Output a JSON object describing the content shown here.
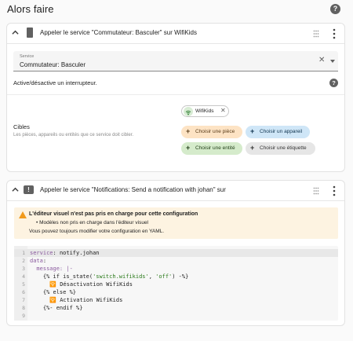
{
  "page": {
    "title": "Alors faire"
  },
  "card1": {
    "header_title": "Appeler le service \"Commutateur: Basculer\" sur WifiKids",
    "service_field": {
      "label": "Service",
      "value": "Commutateur: Basculer"
    },
    "description": "Active/désactive un interrupteur.",
    "targets": {
      "title": "Cibles",
      "subtitle": "Les pièces, appareils ou entités que ce service doit cibler.",
      "entity_chip": "WifiKids",
      "choose_area": "Choisir une pièce",
      "choose_device": "Choisir un appareil",
      "choose_entity": "Choisir une entité",
      "choose_label": "Choisir une étiquette"
    }
  },
  "card2": {
    "header_title": "Appeler le service \"Notifications: Send a notification with johan\" sur",
    "warning": {
      "title": "L'éditeur visuel n'est pas pris en charge pour cette configuration",
      "bullet": "Modèles non pris en charge dans l'éditeur visuel",
      "text": "Vous pouvez toujours modifier votre configuration en YAML."
    },
    "code": {
      "line1_key": "service",
      "line1_val": " notify.johan",
      "line2_key": "data",
      "line3": "  message: |-",
      "line4a": "    {% if is_state(",
      "line4b": "'switch.wifikids'",
      "line4c": ", ",
      "line4d": "'off'",
      "line4e": ") -%}",
      "line5": "      🛜 Désactivation WifiKids",
      "line6": "    {% else %}",
      "line7": "      🛜 Activation WifiKids",
      "line8": "    {%- endif %}",
      "line9": ""
    }
  },
  "colors": {
    "warning": "#f19a1c",
    "area": "#fde3c4",
    "device": "#cfe6f7",
    "entity": "#d5ebcb",
    "label": "#e6e6e6"
  },
  "icons": [
    "help-circle-icon",
    "chevron-up-icon",
    "switch-icon",
    "message-alert-icon",
    "drag-handle-icon",
    "more-vertical-icon",
    "close-icon",
    "dropdown-arrow-icon",
    "wifi-icon",
    "plus-icon",
    "alert-triangle-icon"
  ]
}
